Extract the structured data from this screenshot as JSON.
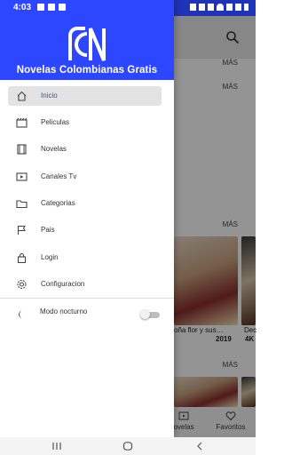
{
  "status_bar": {
    "time": "4:03",
    "battery": "▮"
  },
  "background_screen": {
    "more_labels": [
      "MÁS",
      "MÁS",
      "MÁS",
      "MÁS"
    ],
    "cards": [
      {
        "title": "oña flor y sus…",
        "year": "2019"
      },
      {
        "title": "Dec",
        "year": "4K"
      }
    ],
    "bottom_nav": [
      {
        "label": "ovelas",
        "icon": "tv-icon"
      },
      {
        "label": "Favoritos",
        "icon": "heart-icon"
      }
    ]
  },
  "drawer": {
    "app_title": "Novelas Colombianas Gratis",
    "logo_icon": "rcn-logo",
    "menu": [
      {
        "label": "Inicio",
        "icon": "home-icon",
        "active": true
      },
      {
        "label": "Peliculas",
        "icon": "movie-icon",
        "active": false
      },
      {
        "label": "Novelas",
        "icon": "film-strip-icon",
        "active": false
      },
      {
        "label": "Canales Tv",
        "icon": "tv-icon",
        "active": false
      },
      {
        "label": "Categorias",
        "icon": "folder-icon",
        "active": false
      },
      {
        "label": "Pais",
        "icon": "flag-icon",
        "active": false
      },
      {
        "label": "Login",
        "icon": "lock-icon",
        "active": false
      },
      {
        "label": "Configuracion",
        "icon": "gear-icon",
        "active": false
      }
    ],
    "night_mode": {
      "label": "Modo nocturno",
      "icon": "moon-icon",
      "enabled": false
    }
  },
  "colors": {
    "primary": "#2C47FF",
    "active_item_bg": "#e3e3e3",
    "active_text": "#2C47FF"
  }
}
